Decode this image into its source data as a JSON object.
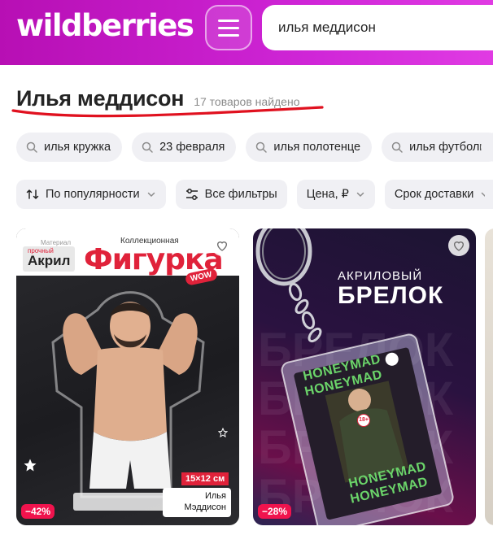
{
  "header": {
    "logo": "wildberries",
    "search_value": "илья меддисон"
  },
  "results": {
    "title": "Илья меддисон",
    "count": "17 товаров найдено"
  },
  "suggestions": [
    "илья кружка",
    "23 февраля",
    "илья полотенце",
    "илья футболка"
  ],
  "filters": {
    "sort": "По популярности",
    "all_filters": "Все фильтры",
    "price": "Цена, ₽",
    "delivery": "Срок доставки"
  },
  "cards": [
    {
      "discount": "−42%",
      "material_label": "Материал",
      "strong_label": "прочный",
      "akril_label": "Акрил",
      "collection_label": "Коллекционная",
      "type_label": "Фигурка",
      "wow_label": "WOW",
      "size_label": "15×12 см",
      "name_line1": "Илья",
      "name_line2": "Мэддисон"
    },
    {
      "discount": "−28%",
      "subtitle": "АКРИЛОВЫЙ",
      "title": "БРЕЛОК",
      "bg_text": "БРЕЛОК",
      "tag_text": "HONEYMAD",
      "age_label": "18+"
    }
  ],
  "colors": {
    "brand_gradient_start": "#b70fb4",
    "brand_gradient_end": "#e03be3",
    "discount": "#f0134d",
    "underline": "#e0111f"
  }
}
